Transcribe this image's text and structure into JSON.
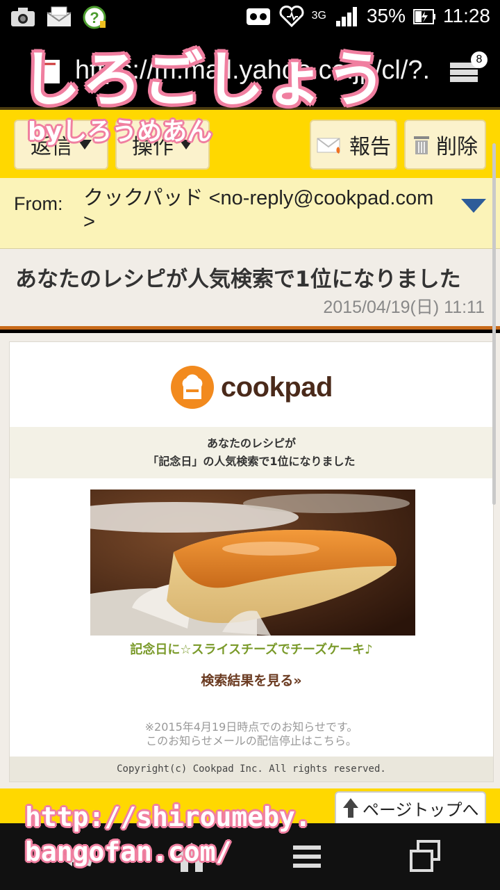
{
  "status_bar": {
    "battery": "35%",
    "time": "11:28",
    "network": "3G",
    "icons": [
      "camera-icon",
      "mail-icon",
      "help-icon",
      "voicemail-icon",
      "heart-icon",
      "signal-icon",
      "battery-icon"
    ]
  },
  "browser": {
    "url": "https://m.mail.yahoo.co.jp/cl/?.",
    "tab_count": "8"
  },
  "watermark": {
    "title": "しろごしょう",
    "subtitle": "byしろうめあん",
    "url_line1": "http://shiroumeby.",
    "url_line2": "bangofan.com/"
  },
  "toolbar": {
    "reply_label": "返信",
    "ops_label": "操作",
    "report_label": "報告",
    "delete_label": "削除"
  },
  "message": {
    "from_label": "From:",
    "from_value": "クックパッド <no-reply@cookpad.com >",
    "subject": "あなたのレシピが人気検索で1位になりました",
    "date": "2015/04/19(日) 11:11"
  },
  "mail_body": {
    "logo_text": "cookpad",
    "headline_line1": "あなたのレシピが",
    "headline_line2": "「記念日」の人気検索で1位になりました",
    "recipe_title": "記念日に☆スライスチーズでチーズケーキ♪",
    "search_link": "検索結果を見る»",
    "notice_line1": "※2015年4月19日時点でのお知らせです。",
    "notice_line2": "このお知らせメールの配信停止はこちら。",
    "copyright": "Copyright(c) Cookpad Inc. All rights reserved."
  },
  "footer": {
    "page_top_label": "ページトップへ"
  },
  "colors": {
    "toolbar_yellow": "#ffd800",
    "from_bg": "#fbf3b8",
    "accent_orange": "#c86a1a",
    "cookpad_orange": "#f28a1e",
    "recipe_green": "#7a9a2a",
    "watermark_pink": "#f07fa0"
  }
}
